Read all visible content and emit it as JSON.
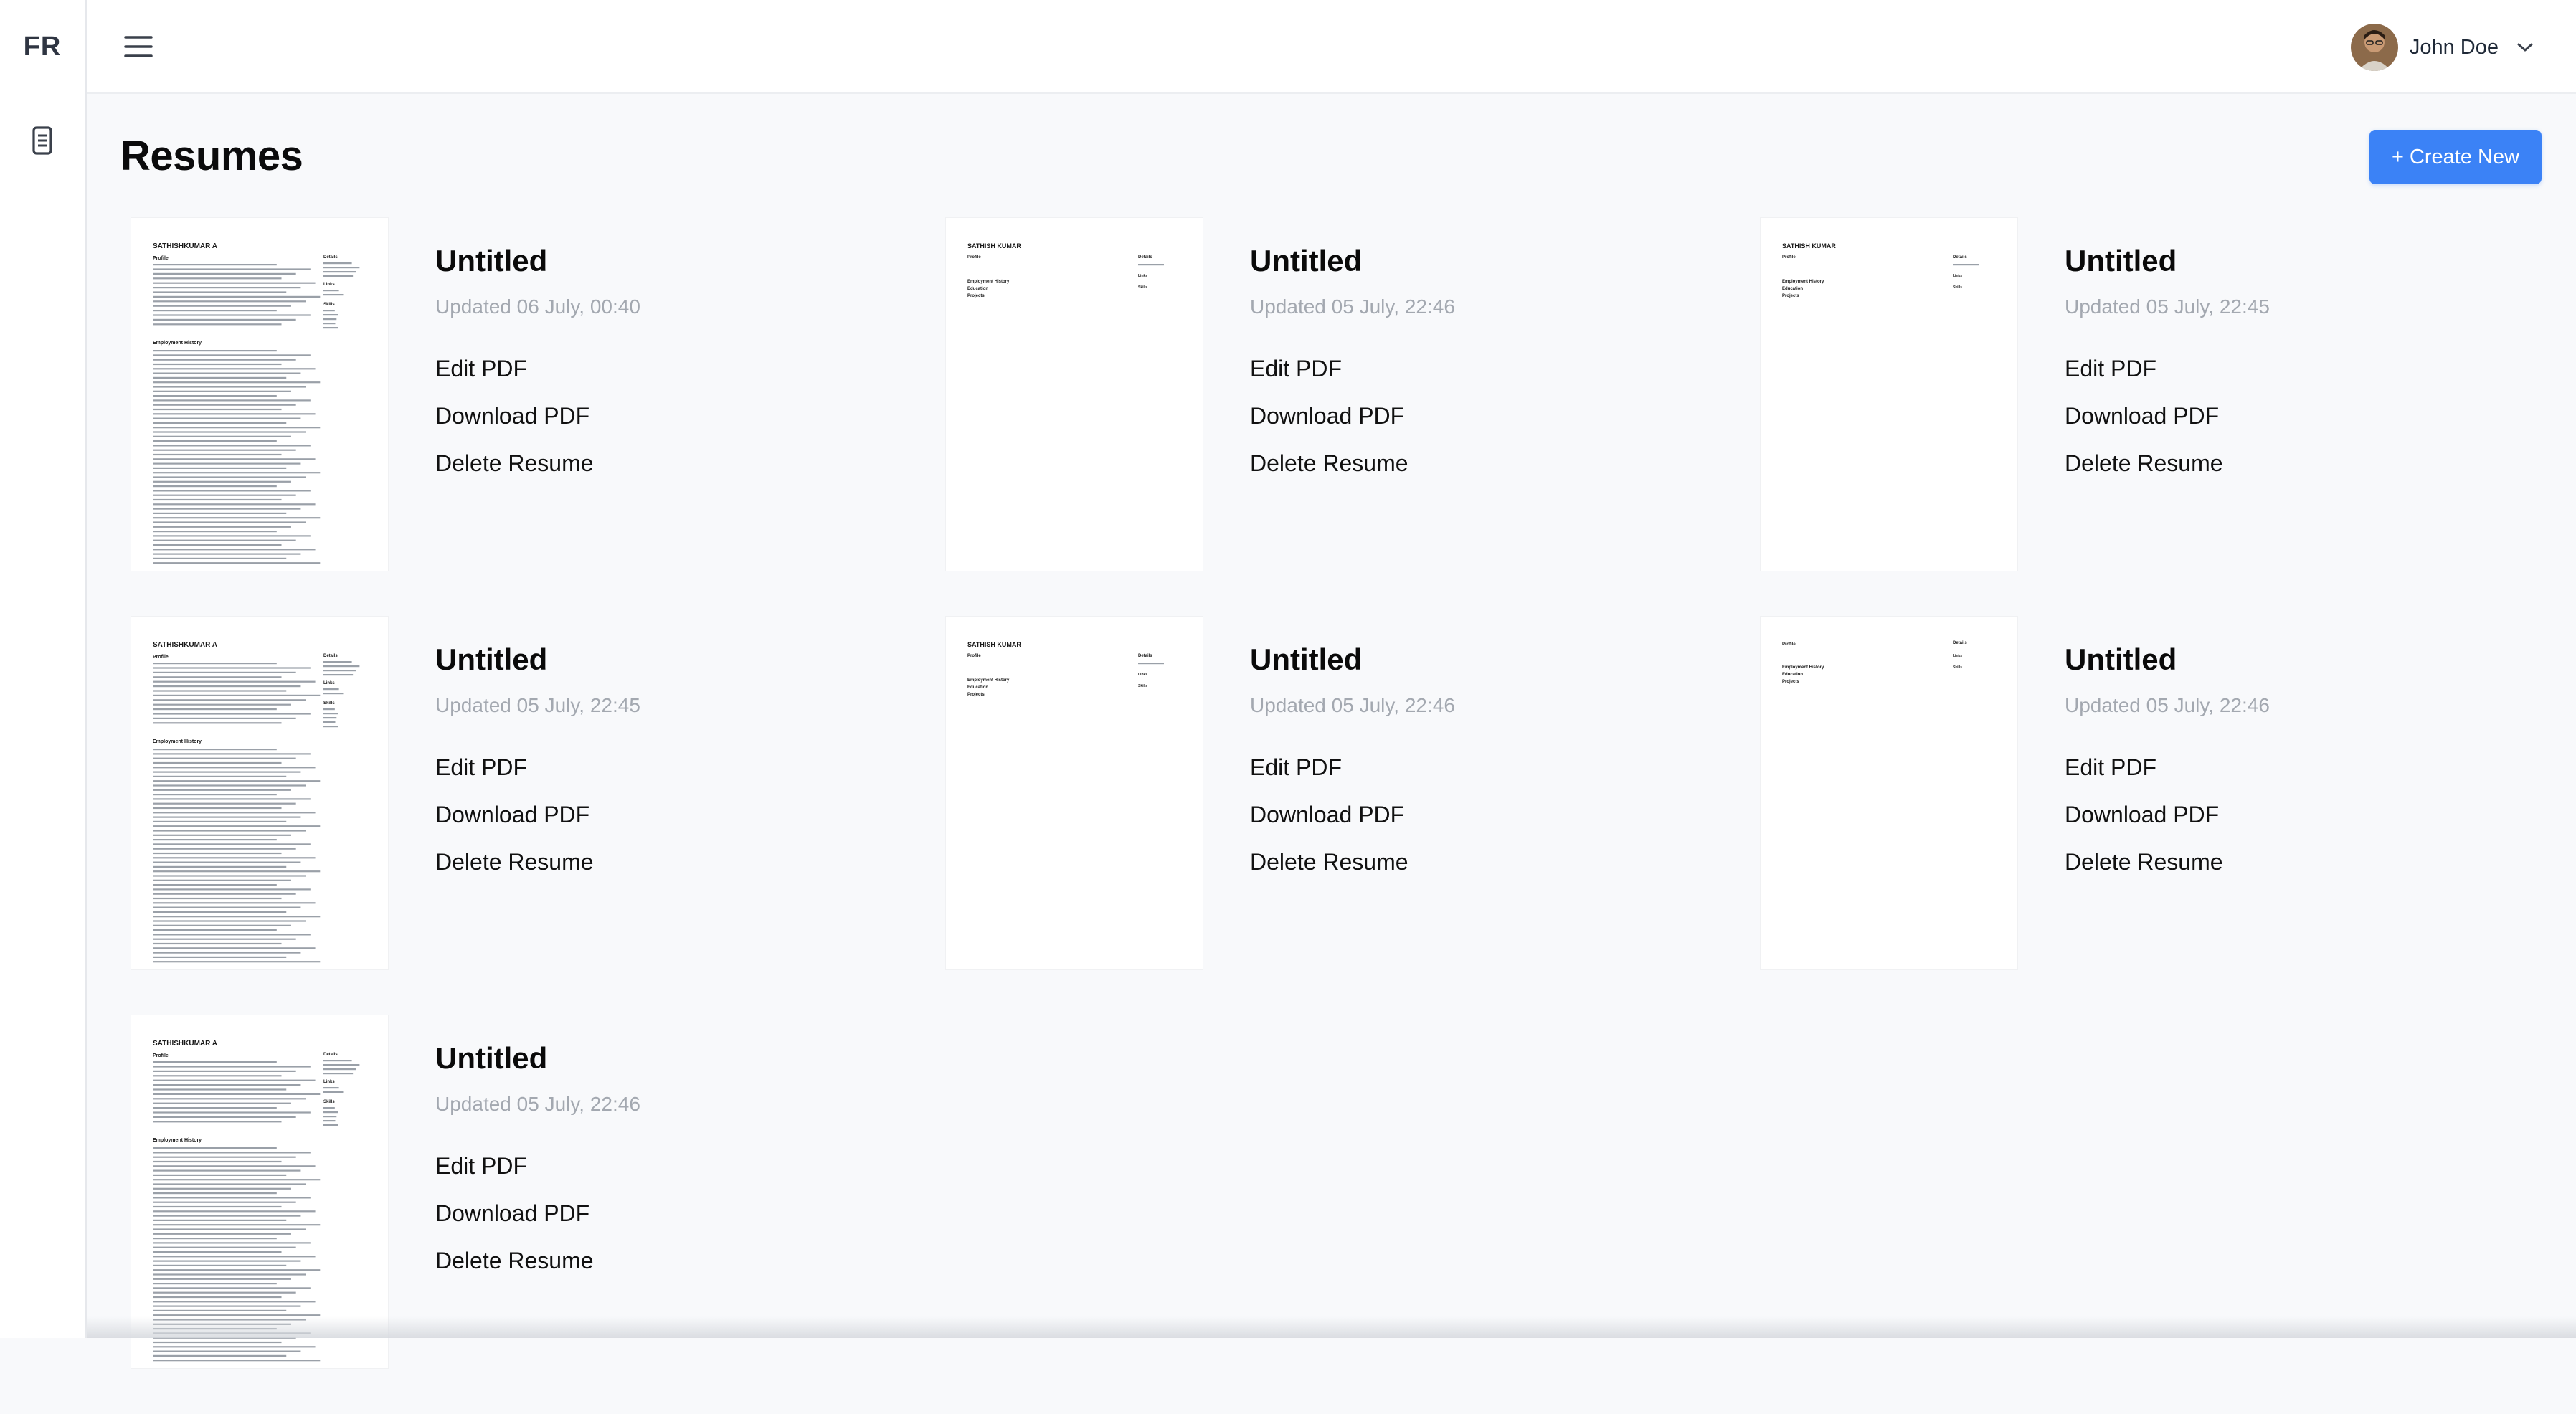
{
  "app": {
    "logo": "FR"
  },
  "header": {
    "user_name": "John Doe"
  },
  "main": {
    "title": "Resumes",
    "create_button": "+ Create New",
    "actions": {
      "edit": "Edit PDF",
      "download": "Download PDF",
      "delete": "Delete Resume"
    }
  },
  "resumes": [
    {
      "title": "Untitled",
      "updated": "Updated 06 July, 00:40",
      "thumb_variant": "full",
      "name": "SATHISHKUMAR A"
    },
    {
      "title": "Untitled",
      "updated": "Updated 05 July, 22:46",
      "thumb_variant": "sparse",
      "name": "SATHISH KUMAR"
    },
    {
      "title": "Untitled",
      "updated": "Updated 05 July, 22:45",
      "thumb_variant": "sparse",
      "name": "SATHISH KUMAR"
    },
    {
      "title": "Untitled",
      "updated": "Updated 05 July, 22:45",
      "thumb_variant": "full",
      "name": "SATHISHKUMAR A"
    },
    {
      "title": "Untitled",
      "updated": "Updated 05 July, 22:46",
      "thumb_variant": "sparse",
      "name": "SATHISH KUMAR"
    },
    {
      "title": "Untitled",
      "updated": "Updated 05 July, 22:46",
      "thumb_variant": "blank",
      "name": ""
    },
    {
      "title": "Untitled",
      "updated": "Updated 05 July, 22:46",
      "thumb_variant": "full",
      "name": "SATHISHKUMAR A"
    }
  ],
  "thumb_text": {
    "profile": "Profile",
    "details": "Details",
    "employment": "Employment History",
    "education": "Education",
    "projects": "Projects",
    "links": "Links",
    "skills": "Skills"
  }
}
